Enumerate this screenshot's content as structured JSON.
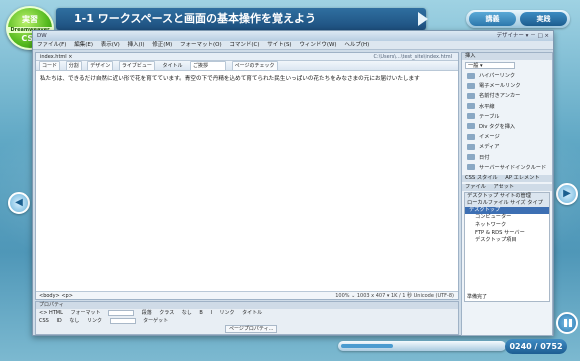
{
  "lesson": {
    "badge_line1": "実習",
    "badge_line2": "Dreamweaver",
    "badge_line3": "CS4",
    "title": "1-1 ワークスペースと画面の基本操作を覚えよう",
    "mode_tabs": [
      "講義",
      "実践"
    ]
  },
  "dreamweaver": {
    "window_title": "DW",
    "window_right": "デザイナー ▾   －  □  ×",
    "menus": [
      "ファイル(F)",
      "編集(E)",
      "表示(V)",
      "挿入(I)",
      "修正(M)",
      "フォーマット(O)",
      "コマンド(C)",
      "サイト(S)",
      "ウィンドウ(W)",
      "ヘルプ(H)"
    ],
    "doc_tab": "index.html ×",
    "doc_path": "C:\\Users\\...\\test_site\\index.html",
    "toolbar": {
      "code": "コード",
      "split": "分割",
      "design": "デザイン",
      "live": "ライブビュー",
      "title_label": "タイトル",
      "title_value": "ご挨拶",
      "check": "ページのチェック"
    },
    "body_text": "私たちは、できるだけ自然に近い形で花を育てています。青空の下で丹精を込めて育てられた民生いっぱいの花たちをみなさまの元にお届けいたします",
    "status_left": "<body> <p>",
    "status_right": "100%  ⌄  1003 x 407 ▾  1K / 1 秒  Unicode (UTF-8)",
    "props": {
      "header": "プロパティ",
      "row1": [
        "<> HTML",
        "フォーマット",
        "段落",
        "クラス",
        "なし",
        "B",
        "I",
        "リンク",
        "タイトル"
      ],
      "row2": [
        "CSS",
        "ID",
        "なし",
        "リンク",
        "ターゲット"
      ],
      "button": "ページプロパティ..."
    },
    "insert_panel": {
      "header": "挿入",
      "category": "一般 ▾",
      "items": [
        "ハイパーリンク",
        "電子メールリンク",
        "名前付きアンカー",
        "水平線",
        "テーブル",
        "Div タグを挿入",
        "イメージ",
        "メディア",
        "日付",
        "サーバーサイドインクルード"
      ]
    },
    "panel_tabs": [
      "CSS スタイル",
      "AP エレメント"
    ],
    "files_tabs": [
      "ファイル",
      "アセット"
    ],
    "files": {
      "header": "デスクトップ   サイトの管理",
      "col": "ローカルファイル     サイズ タイプ",
      "tree": [
        "デスクトップ",
        "コンピューター",
        "ネットワーク",
        "FTP & RDS サーバー",
        "デスクトップ項目"
      ],
      "bottom": "準備完了"
    }
  },
  "player": {
    "time": "0240 / 0752",
    "progress": 0.32
  }
}
